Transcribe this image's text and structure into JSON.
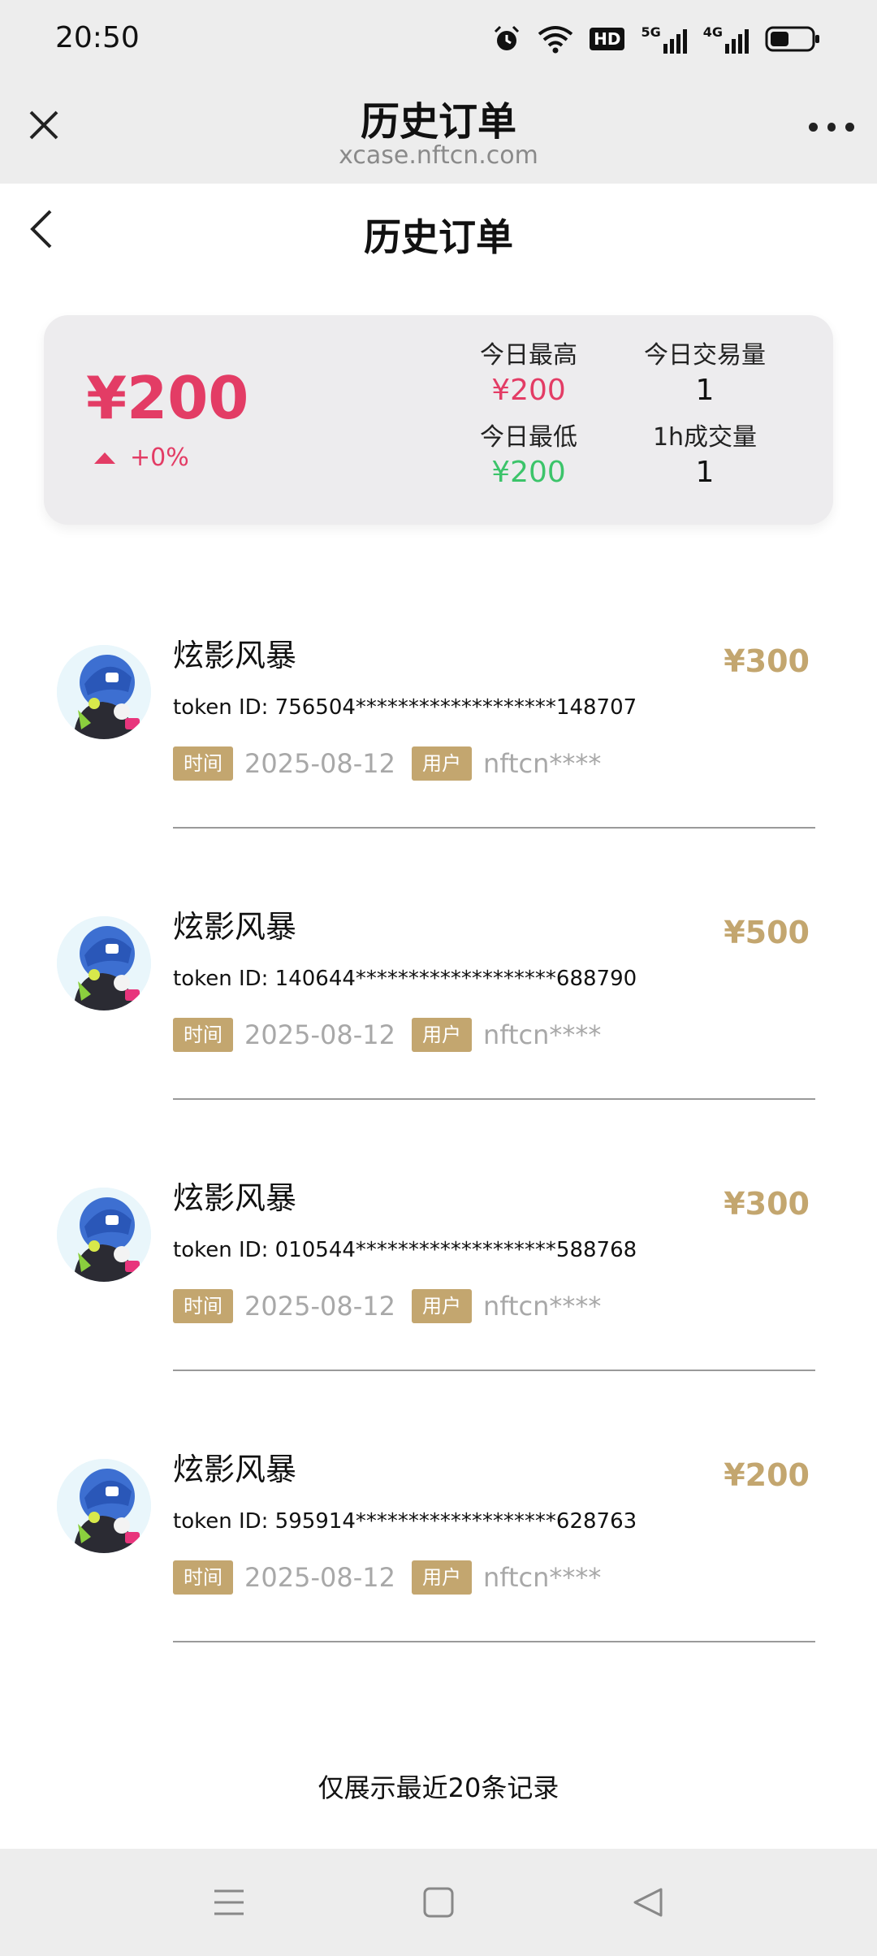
{
  "status_bar": {
    "time": "20:50",
    "icons": [
      "alarm-icon",
      "wifi-icon",
      "hd-icon",
      "signal-5g-icon",
      "signal-4g-icon",
      "battery-icon"
    ],
    "hd_label": "HD",
    "net_5g": "5G",
    "net_4g": "4G"
  },
  "webview": {
    "title": "历史订单",
    "domain": "xcase.nftcn.com"
  },
  "page": {
    "title": "历史订单"
  },
  "summary": {
    "price": "¥200",
    "change": "+0%",
    "today_high_label": "今日最高",
    "today_high": "¥200",
    "today_volume_label": "今日交易量",
    "today_volume": "1",
    "today_low_label": "今日最低",
    "today_low": "¥200",
    "hour_volume_label": "1h成交量",
    "hour_volume": "1",
    "colors": {
      "up": "#e33c65",
      "down": "#3cc46a",
      "gold": "#c3a66f"
    }
  },
  "orders": [
    {
      "name": "炫影风暴",
      "price": "¥300",
      "token": "token ID: 756504*******************148707",
      "time_label": "时间",
      "time": "2025-08-12",
      "user_label": "用户",
      "user": "nftcn****"
    },
    {
      "name": "炫影风暴",
      "price": "¥500",
      "token": "token ID: 140644*******************688790",
      "time_label": "时间",
      "time": "2025-08-12",
      "user_label": "用户",
      "user": "nftcn****"
    },
    {
      "name": "炫影风暴",
      "price": "¥300",
      "token": "token ID: 010544*******************588768",
      "time_label": "时间",
      "time": "2025-08-12",
      "user_label": "用户",
      "user": "nftcn****"
    },
    {
      "name": "炫影风暴",
      "price": "¥200",
      "token": "token ID: 595914*******************628763",
      "time_label": "时间",
      "time": "2025-08-12",
      "user_label": "用户",
      "user": "nftcn****"
    }
  ],
  "footer_note": "仅展示最近20条记录",
  "navbar": {
    "buttons": [
      "menu-icon",
      "home-square-icon",
      "back-triangle-icon"
    ]
  }
}
